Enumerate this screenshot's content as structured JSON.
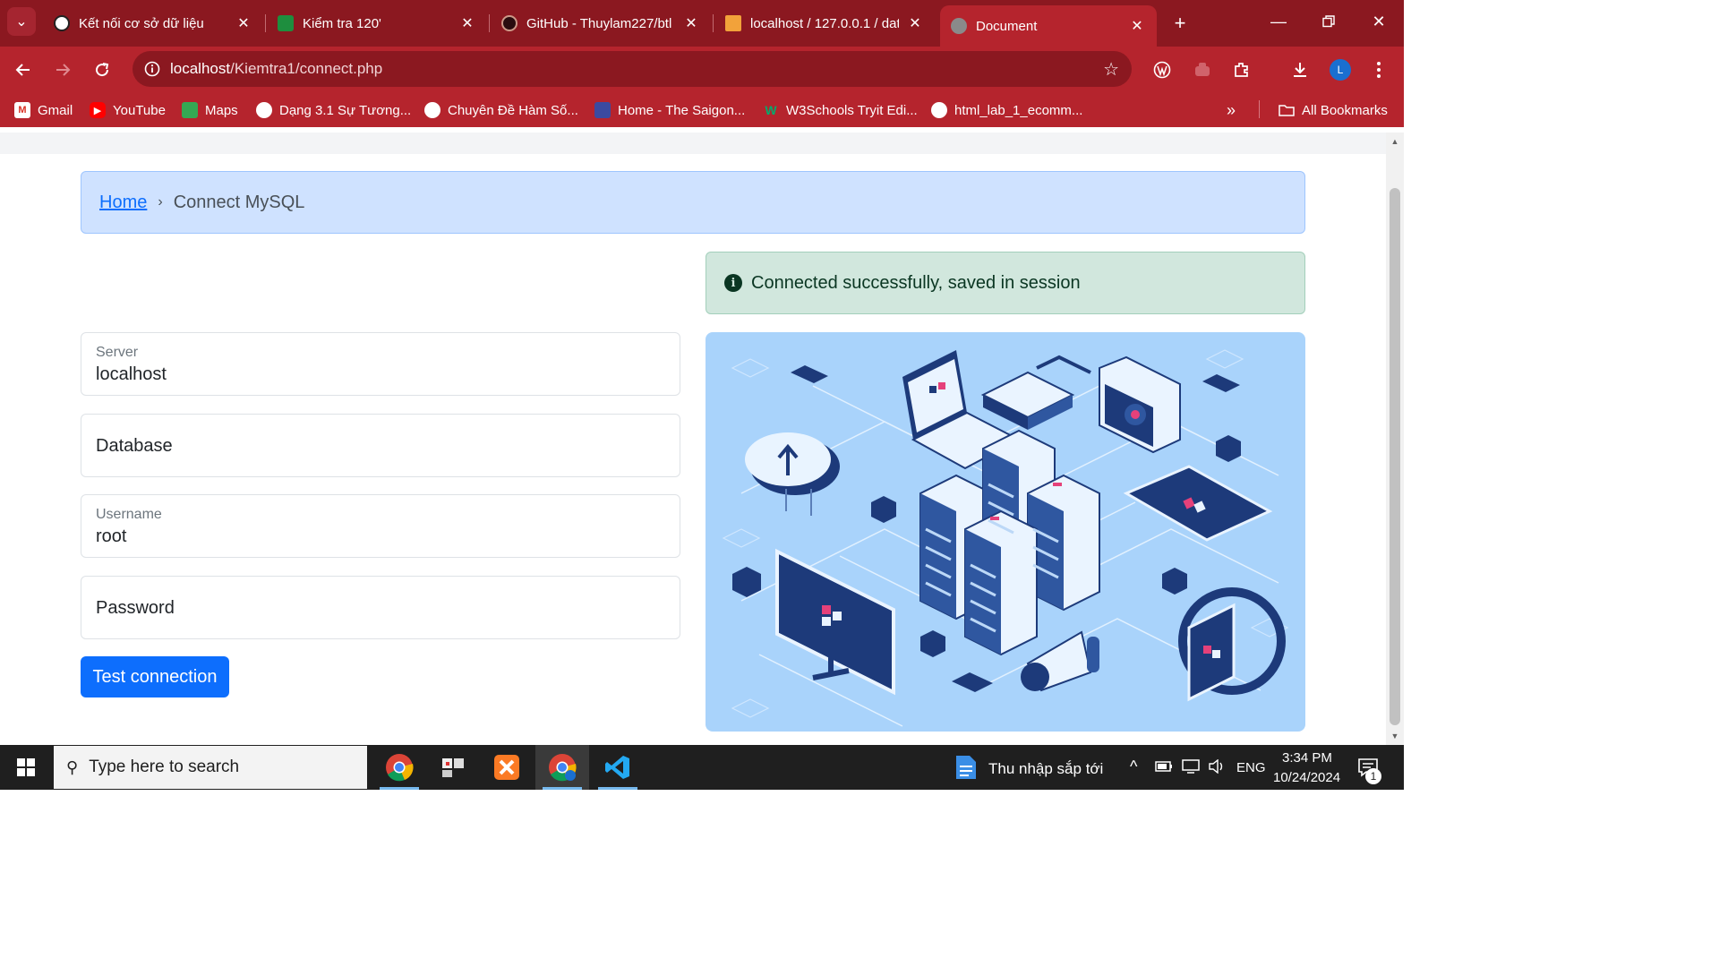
{
  "browser": {
    "tabs": [
      {
        "title": "Kết nối cơ sở dữ liệu",
        "active": false
      },
      {
        "title": "Kiểm tra 120'",
        "active": false
      },
      {
        "title": "GitHub - Thuylam227/btl",
        "active": false
      },
      {
        "title": "localhost / 127.0.0.1 / dat",
        "active": false
      },
      {
        "title": "Document",
        "active": true
      }
    ],
    "address": {
      "host": "localhost",
      "path": "/Kiemtra1/connect.php"
    },
    "profile_initial": "L",
    "bookmarks": [
      {
        "label": "Gmail",
        "icon": "gmail-icon"
      },
      {
        "label": "YouTube",
        "icon": "youtube-icon"
      },
      {
        "label": "Maps",
        "icon": "maps-icon"
      },
      {
        "label": "Dạng 3.1 Sự Tương...",
        "icon": "globe-icon"
      },
      {
        "label": "Chuyên Đề Hàm Số...",
        "icon": "globe-icon"
      },
      {
        "label": "Home - The Saigon...",
        "icon": "saigon-icon"
      },
      {
        "label": "W3Schools Tryit Edi...",
        "icon": "w3schools-icon"
      },
      {
        "label": "html_lab_1_ecomm...",
        "icon": "github-icon"
      }
    ],
    "all_bookmarks": "All Bookmarks"
  },
  "page": {
    "breadcrumb": {
      "home": "Home",
      "current": "Connect MySQL"
    },
    "alert": "Connected successfully, saved in session",
    "form": {
      "server": {
        "label": "Server",
        "value": "localhost"
      },
      "database": {
        "placeholder": "Database"
      },
      "username": {
        "label": "Username",
        "value": "root"
      },
      "password": {
        "placeholder": "Password"
      },
      "submit": "Test connection"
    }
  },
  "taskbar": {
    "search_placeholder": "Type here to search",
    "weather": "Thu nhập sắp tới",
    "language": "ENG",
    "time": "3:34 PM",
    "date": "10/24/2024",
    "notification_count": "1"
  },
  "colors": {
    "browser_dark": "#8b1820",
    "browser_main": "#b5242d",
    "primary": "#0d6efd",
    "breadcrumb_bg": "#cfe2ff",
    "alert_bg": "#d1e7dd",
    "illustration_bg": "#a9d3fb"
  }
}
